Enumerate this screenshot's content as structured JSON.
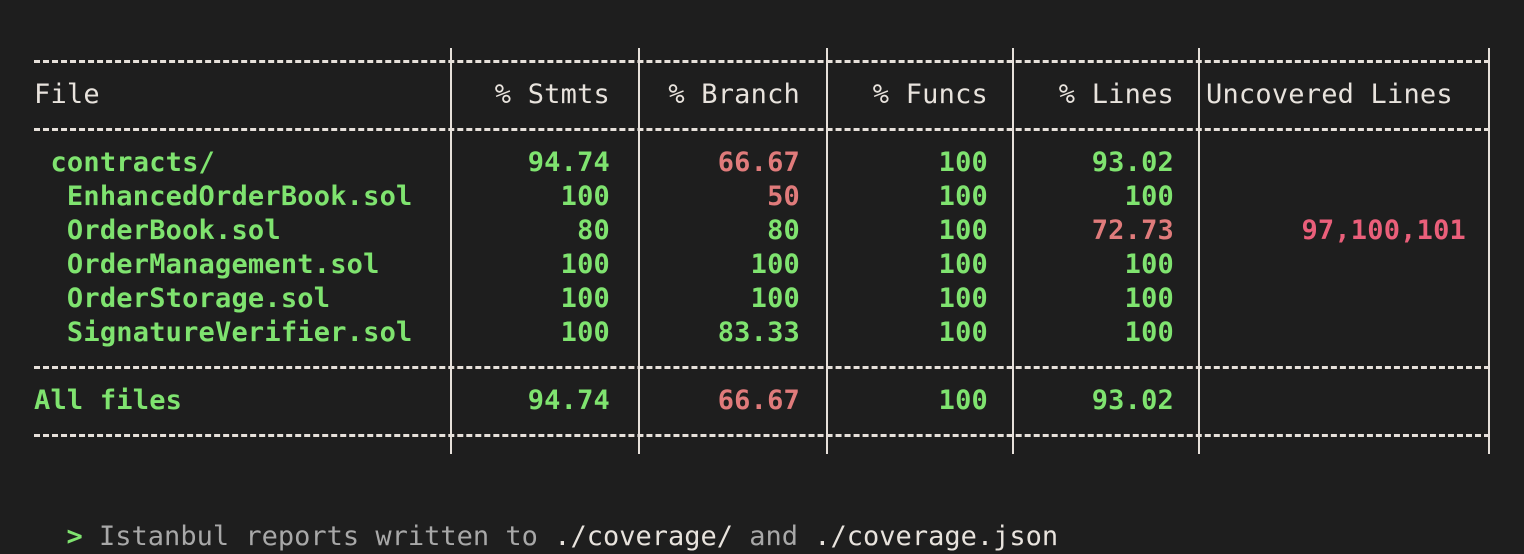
{
  "table": {
    "headers": {
      "file": "File",
      "stmts": "% Stmts",
      "branch": "% Branch",
      "funcs": "% Funcs",
      "lines": "% Lines",
      "uncovered": "Uncovered Lines"
    },
    "rows": [
      {
        "file": " contracts/",
        "stmts": "94.74",
        "branch": "66.67",
        "funcs": "100",
        "lines": "93.02",
        "uncovered": ""
      },
      {
        "file": "  EnhancedOrderBook.sol",
        "stmts": "100",
        "branch": "50",
        "funcs": "100",
        "lines": "100",
        "uncovered": ""
      },
      {
        "file": "  OrderBook.sol",
        "stmts": "80",
        "branch": "80",
        "funcs": "100",
        "lines": "72.73",
        "uncovered": "97,100,101"
      },
      {
        "file": "  OrderManagement.sol",
        "stmts": "100",
        "branch": "100",
        "funcs": "100",
        "lines": "100",
        "uncovered": ""
      },
      {
        "file": "  OrderStorage.sol",
        "stmts": "100",
        "branch": "100",
        "funcs": "100",
        "lines": "100",
        "uncovered": ""
      },
      {
        "file": "  SignatureVerifier.sol",
        "stmts": "100",
        "branch": "83.33",
        "funcs": "100",
        "lines": "100",
        "uncovered": ""
      }
    ],
    "total": {
      "file": "All files",
      "stmts": "94.74",
      "branch": "66.67",
      "funcs": "100",
      "lines": "93.02",
      "uncovered": ""
    }
  },
  "footer": {
    "caret": ">",
    "text_before": " Istanbul reports written to ",
    "path1": "./coverage/",
    "text_middle": " and ",
    "path2": "./coverage.json"
  }
}
